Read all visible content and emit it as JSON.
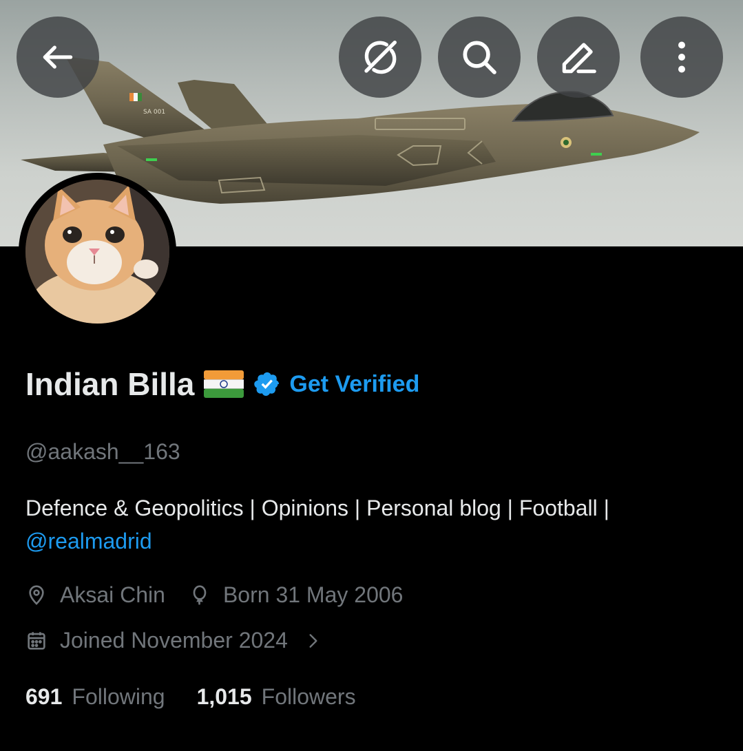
{
  "profile": {
    "display_name": "Indian Billa",
    "get_verified_label": "Get Verified",
    "handle": "@aakash__163",
    "bio_text": "Defence & Geopolitics | Opinions | Personal blog | Football |",
    "bio_mention": "@realmadrid",
    "location": "Aksai Chin",
    "birthday": "Born 31 May 2006",
    "joined": "Joined November 2024",
    "following_count": "691",
    "following_label": "Following",
    "followers_count": "1,015",
    "followers_label": "Followers"
  },
  "header_icons": [
    "back-arrow-icon",
    "grok-icon",
    "search-icon",
    "edit-icon",
    "more-vertical-icon"
  ],
  "meta_icons": [
    "location-pin-icon",
    "balloon-icon",
    "calendar-icon",
    "chevron-right-icon"
  ],
  "banner": {
    "jet_tail_marking": "SA 001"
  },
  "colors": {
    "background": "#000000",
    "primary_text": "#e7e9ea",
    "secondary_text": "#71767b",
    "accent_blue": "#1d9bf0",
    "header_button_bg": "#404244"
  }
}
